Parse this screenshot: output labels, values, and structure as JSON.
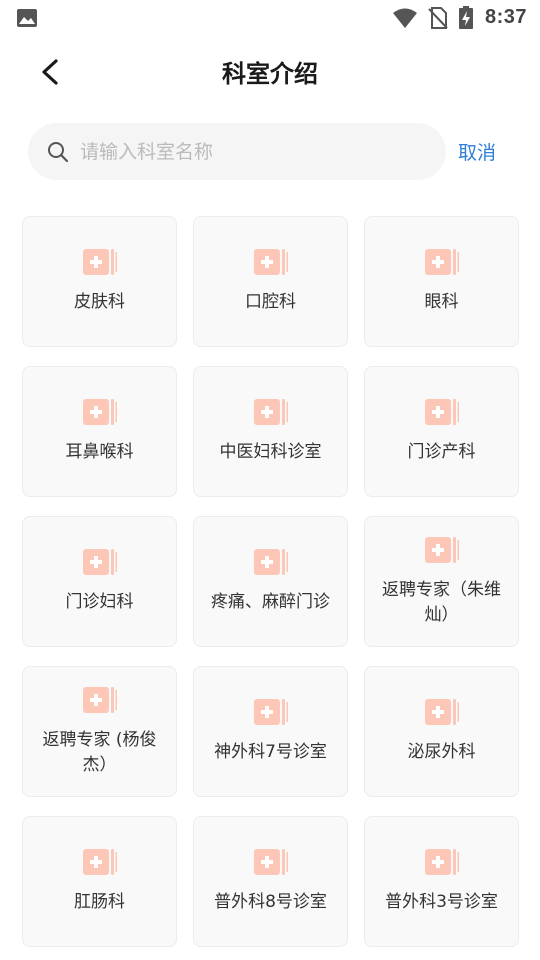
{
  "status_bar": {
    "time": "8:37",
    "icons": [
      "gallery-icon",
      "wifi-icon",
      "no-sim-icon",
      "battery-charging-icon"
    ]
  },
  "header": {
    "back_icon": "chevron-left-icon",
    "title": "科室介绍"
  },
  "search": {
    "placeholder": "请输入科室名称",
    "value": "",
    "cancel_label": "取消"
  },
  "colors": {
    "accent": "#2f7fd8",
    "icon_fill": "#fcc7b7",
    "card_bg": "#f9f9f9"
  },
  "departments": [
    {
      "name": "皮肤科"
    },
    {
      "name": "口腔科"
    },
    {
      "name": "眼科"
    },
    {
      "name": "耳鼻喉科"
    },
    {
      "name": "中医妇科诊室"
    },
    {
      "name": "门诊产科"
    },
    {
      "name": "门诊妇科"
    },
    {
      "name": "疼痛、麻醉门诊"
    },
    {
      "name": "返聘专家（朱维灿）"
    },
    {
      "name": "返聘专家 (杨俊杰）"
    },
    {
      "name": "神外科7号诊室"
    },
    {
      "name": "泌尿外科"
    },
    {
      "name": "肛肠科"
    },
    {
      "name": "普外科8号诊室"
    },
    {
      "name": "普外科3号诊室"
    }
  ]
}
